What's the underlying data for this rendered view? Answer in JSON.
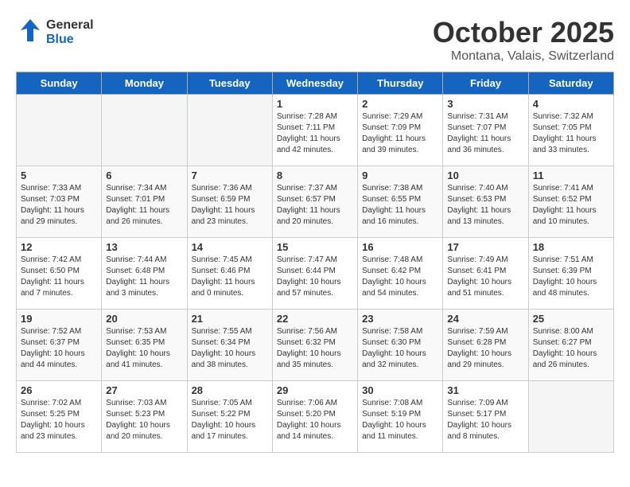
{
  "header": {
    "logo_general": "General",
    "logo_blue": "Blue",
    "month": "October 2025",
    "location": "Montana, Valais, Switzerland"
  },
  "days_of_week": [
    "Sunday",
    "Monday",
    "Tuesday",
    "Wednesday",
    "Thursday",
    "Friday",
    "Saturday"
  ],
  "weeks": [
    [
      {
        "day": "",
        "empty": true
      },
      {
        "day": "",
        "empty": true
      },
      {
        "day": "",
        "empty": true
      },
      {
        "day": "1",
        "sunrise": "7:28 AM",
        "sunset": "7:11 PM",
        "daylight": "11 hours and 42 minutes."
      },
      {
        "day": "2",
        "sunrise": "7:29 AM",
        "sunset": "7:09 PM",
        "daylight": "11 hours and 39 minutes."
      },
      {
        "day": "3",
        "sunrise": "7:31 AM",
        "sunset": "7:07 PM",
        "daylight": "11 hours and 36 minutes."
      },
      {
        "day": "4",
        "sunrise": "7:32 AM",
        "sunset": "7:05 PM",
        "daylight": "11 hours and 33 minutes."
      }
    ],
    [
      {
        "day": "5",
        "sunrise": "7:33 AM",
        "sunset": "7:03 PM",
        "daylight": "11 hours and 29 minutes."
      },
      {
        "day": "6",
        "sunrise": "7:34 AM",
        "sunset": "7:01 PM",
        "daylight": "11 hours and 26 minutes."
      },
      {
        "day": "7",
        "sunrise": "7:36 AM",
        "sunset": "6:59 PM",
        "daylight": "11 hours and 23 minutes."
      },
      {
        "day": "8",
        "sunrise": "7:37 AM",
        "sunset": "6:57 PM",
        "daylight": "11 hours and 20 minutes."
      },
      {
        "day": "9",
        "sunrise": "7:38 AM",
        "sunset": "6:55 PM",
        "daylight": "11 hours and 16 minutes."
      },
      {
        "day": "10",
        "sunrise": "7:40 AM",
        "sunset": "6:53 PM",
        "daylight": "11 hours and 13 minutes."
      },
      {
        "day": "11",
        "sunrise": "7:41 AM",
        "sunset": "6:52 PM",
        "daylight": "11 hours and 10 minutes."
      }
    ],
    [
      {
        "day": "12",
        "sunrise": "7:42 AM",
        "sunset": "6:50 PM",
        "daylight": "11 hours and 7 minutes."
      },
      {
        "day": "13",
        "sunrise": "7:44 AM",
        "sunset": "6:48 PM",
        "daylight": "11 hours and 3 minutes."
      },
      {
        "day": "14",
        "sunrise": "7:45 AM",
        "sunset": "6:46 PM",
        "daylight": "11 hours and 0 minutes."
      },
      {
        "day": "15",
        "sunrise": "7:47 AM",
        "sunset": "6:44 PM",
        "daylight": "10 hours and 57 minutes."
      },
      {
        "day": "16",
        "sunrise": "7:48 AM",
        "sunset": "6:42 PM",
        "daylight": "10 hours and 54 minutes."
      },
      {
        "day": "17",
        "sunrise": "7:49 AM",
        "sunset": "6:41 PM",
        "daylight": "10 hours and 51 minutes."
      },
      {
        "day": "18",
        "sunrise": "7:51 AM",
        "sunset": "6:39 PM",
        "daylight": "10 hours and 48 minutes."
      }
    ],
    [
      {
        "day": "19",
        "sunrise": "7:52 AM",
        "sunset": "6:37 PM",
        "daylight": "10 hours and 44 minutes."
      },
      {
        "day": "20",
        "sunrise": "7:53 AM",
        "sunset": "6:35 PM",
        "daylight": "10 hours and 41 minutes."
      },
      {
        "day": "21",
        "sunrise": "7:55 AM",
        "sunset": "6:34 PM",
        "daylight": "10 hours and 38 minutes."
      },
      {
        "day": "22",
        "sunrise": "7:56 AM",
        "sunset": "6:32 PM",
        "daylight": "10 hours and 35 minutes."
      },
      {
        "day": "23",
        "sunrise": "7:58 AM",
        "sunset": "6:30 PM",
        "daylight": "10 hours and 32 minutes."
      },
      {
        "day": "24",
        "sunrise": "7:59 AM",
        "sunset": "6:28 PM",
        "daylight": "10 hours and 29 minutes."
      },
      {
        "day": "25",
        "sunrise": "8:00 AM",
        "sunset": "6:27 PM",
        "daylight": "10 hours and 26 minutes."
      }
    ],
    [
      {
        "day": "26",
        "sunrise": "7:02 AM",
        "sunset": "5:25 PM",
        "daylight": "10 hours and 23 minutes."
      },
      {
        "day": "27",
        "sunrise": "7:03 AM",
        "sunset": "5:23 PM",
        "daylight": "10 hours and 20 minutes."
      },
      {
        "day": "28",
        "sunrise": "7:05 AM",
        "sunset": "5:22 PM",
        "daylight": "10 hours and 17 minutes."
      },
      {
        "day": "29",
        "sunrise": "7:06 AM",
        "sunset": "5:20 PM",
        "daylight": "10 hours and 14 minutes."
      },
      {
        "day": "30",
        "sunrise": "7:08 AM",
        "sunset": "5:19 PM",
        "daylight": "10 hours and 11 minutes."
      },
      {
        "day": "31",
        "sunrise": "7:09 AM",
        "sunset": "5:17 PM",
        "daylight": "10 hours and 8 minutes."
      },
      {
        "day": "",
        "empty": true
      }
    ]
  ]
}
